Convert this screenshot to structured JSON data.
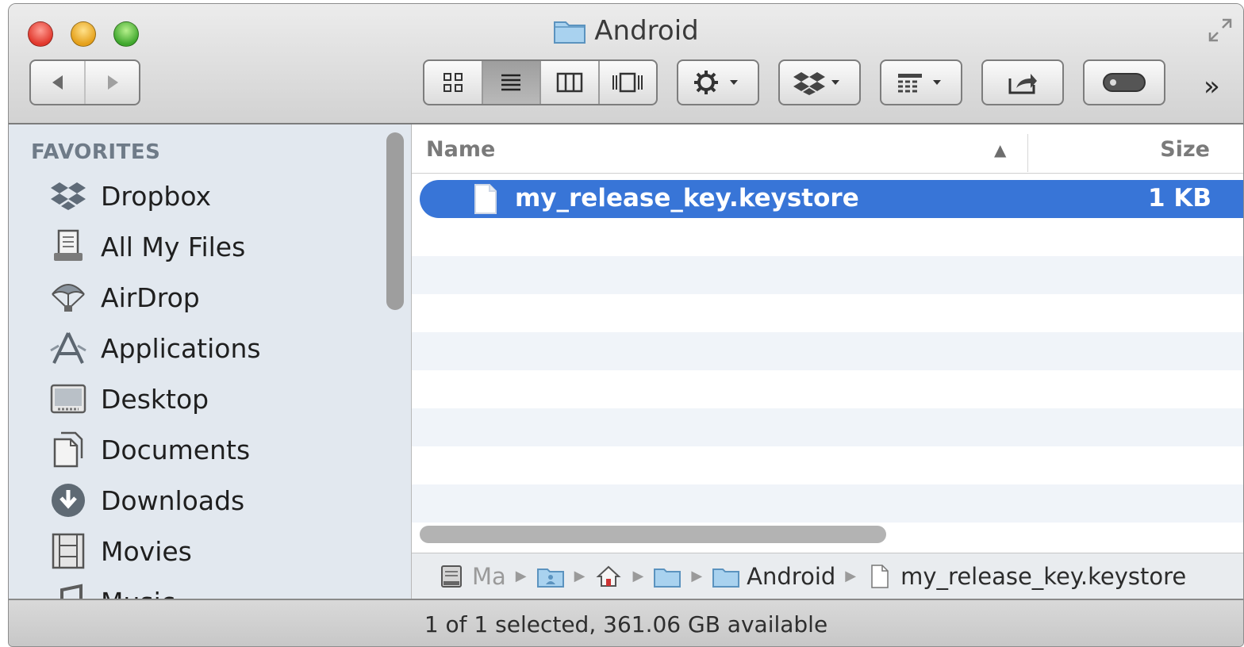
{
  "window": {
    "title": "Android"
  },
  "toolbar": {
    "more_label": "»"
  },
  "sidebar": {
    "heading": "FAVORITES",
    "items": [
      {
        "label": "Dropbox",
        "icon": "dropbox-icon"
      },
      {
        "label": "All My Files",
        "icon": "all-my-files-icon"
      },
      {
        "label": "AirDrop",
        "icon": "airdrop-icon"
      },
      {
        "label": "Applications",
        "icon": "applications-icon"
      },
      {
        "label": "Desktop",
        "icon": "desktop-icon"
      },
      {
        "label": "Documents",
        "icon": "documents-icon"
      },
      {
        "label": "Downloads",
        "icon": "downloads-icon"
      },
      {
        "label": "Movies",
        "icon": "movies-icon"
      },
      {
        "label": "Music",
        "icon": "music-icon"
      }
    ]
  },
  "list": {
    "columns": {
      "name": "Name",
      "size": "Size",
      "sort": "▲"
    },
    "files": [
      {
        "name": "my_release_key.keystore",
        "size": "1 KB",
        "selected": true
      }
    ]
  },
  "pathbar": {
    "disk": "Ma",
    "folder": "Android",
    "file": "my_release_key.keystore"
  },
  "status": {
    "text": "1 of 1 selected, 361.06 GB available"
  },
  "colors": {
    "selection": "#3875d7",
    "sidebar": "#e2e8ef",
    "stripe": "#f0f4f9"
  }
}
